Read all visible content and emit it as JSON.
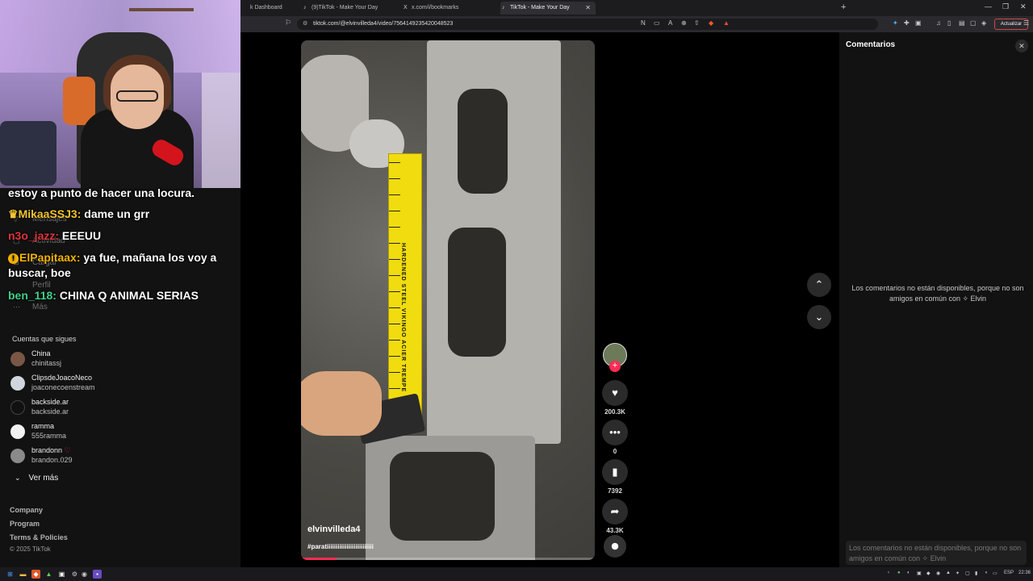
{
  "browser": {
    "tabs": [
      {
        "label": "k Dashboard",
        "icon": "tiktok-icon"
      },
      {
        "label": "(9)TikTok - Make Your Day",
        "icon": "tiktok-icon"
      },
      {
        "label": "x.com/i/bookmarks",
        "icon": "x-icon"
      },
      {
        "label": "TikTok - Make Your Day",
        "icon": "tiktok-icon",
        "active": true
      }
    ],
    "url": "tiktok.com/@elvinvilleda4/video/7564149235420048523",
    "update_label": "Actualizar",
    "accent": "#d04848"
  },
  "chat": [
    {
      "user": "",
      "text": "estoy a punto de hacer una locura.",
      "color": "#ffffff"
    },
    {
      "badge": "crown",
      "user": "MikaaSSJ3:",
      "text": "dame un grr",
      "color": "#f4c430"
    },
    {
      "user": "n3o_jazz:",
      "text": "EEEUU",
      "color": "#e0343c"
    },
    {
      "badge": "!",
      "user": "ElPapitaax:",
      "text": "ya fue, mañana los voy a buscar, boe",
      "color": "#f4b400"
    },
    {
      "user": "ben_118:",
      "text": "CHINA Q ANIMAL SERIAS",
      "color": "#3fd08a"
    }
  ],
  "sidebar_ghost": [
    "Mensajes",
    "Actividad",
    "Cargar",
    "Perfil",
    "Más"
  ],
  "following": {
    "title": "Cuentas que sigues",
    "items": [
      {
        "name": "China",
        "handle": "chinitassj"
      },
      {
        "name": "ClipsdeJoacoNeco",
        "handle": "joaconecoenstream"
      },
      {
        "name": "backside.ar",
        "handle": "backside.ar"
      },
      {
        "name": "ramma",
        "handle": "555ramma"
      },
      {
        "name": "brandonn",
        "handle": "brandon.029"
      }
    ],
    "see_more": "Ver más"
  },
  "footer": {
    "links": [
      "Company",
      "Program",
      "Terms & Policies"
    ],
    "copyright": "© 2025 TikTok"
  },
  "video": {
    "username": "elvinvilleda4",
    "hashtag": "#paratiiiiiiiiiiiiiiiiiiiiiiiiii",
    "progress": 0.12,
    "tape_label": "HARDENED STEEL VIKINGO ACIER TREMPE",
    "likes": "200.3K",
    "comments": "0",
    "saves": "7392",
    "shares": "43.3K"
  },
  "comments_panel": {
    "title": "Comentarios",
    "message": "Los comentarios no están disponibles, porque no son amigos en común con ✧ Elvin⁣⁣⁣",
    "box_message": "Los comentarios no están disponibles, porque no son amigos en común con ✧ Elvin⁣⁣⁣"
  },
  "taskbar": {
    "lang": "ESP",
    "time": "22:36"
  }
}
